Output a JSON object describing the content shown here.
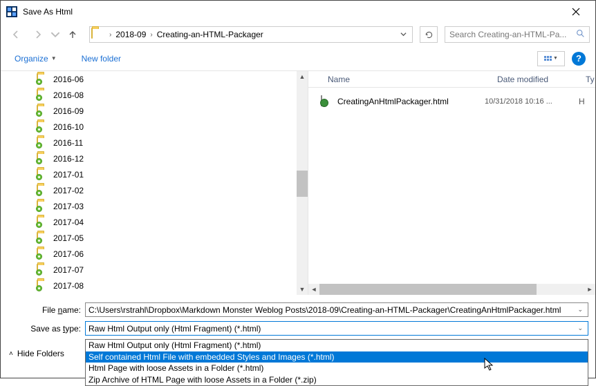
{
  "window": {
    "title": "Save As Html"
  },
  "nav": {
    "crumbs": [
      "2018-09",
      "Creating-an-HTML-Packager"
    ],
    "search_placeholder": "Search Creating-an-HTML-Pa..."
  },
  "toolbar": {
    "organize": "Organize",
    "newfolder": "New folder"
  },
  "tree": {
    "items": [
      {
        "label": "2016-06"
      },
      {
        "label": "2016-08"
      },
      {
        "label": "2016-09"
      },
      {
        "label": "2016-10"
      },
      {
        "label": "2016-11"
      },
      {
        "label": "2016-12"
      },
      {
        "label": "2017-01"
      },
      {
        "label": "2017-02"
      },
      {
        "label": "2017-03"
      },
      {
        "label": "2017-04"
      },
      {
        "label": "2017-05"
      },
      {
        "label": "2017-06"
      },
      {
        "label": "2017-07"
      },
      {
        "label": "2017-08"
      }
    ],
    "scroll": {
      "thumb_top_pct": 44,
      "thumb_height_pct": 13
    }
  },
  "files": {
    "columns": {
      "name": "Name",
      "date": "Date modified",
      "type": "Ty"
    },
    "rows": [
      {
        "name": "CreatingAnHtmlPackager.html",
        "date": "10/31/2018 10:16 ...",
        "type": "H"
      }
    ],
    "hscroll": {
      "thumb_left_pct": 0,
      "thumb_width_pct": 82
    }
  },
  "form": {
    "filename_label": "File name:",
    "filename_value": "C:\\Users\\rstrahl\\Dropbox\\Markdown Monster Weblog Posts\\2018-09\\Creating-an-HTML-Packager\\CreatingAnHtmlPackager.html",
    "savetype_label": "Save as type:",
    "savetype_value": "Raw Html Output only (Html Fragment) (*.html)",
    "options": [
      "Raw Html Output only (Html Fragment) (*.html)",
      "Self contained Html File with embedded Styles and Images (*.html)",
      "Html Page with loose Assets in a Folder (*.html)",
      "Zip Archive of HTML Page  with loose Assets in a Folder (*.zip)"
    ],
    "selected_index": 1,
    "hide_folders": "Hide Folders"
  }
}
